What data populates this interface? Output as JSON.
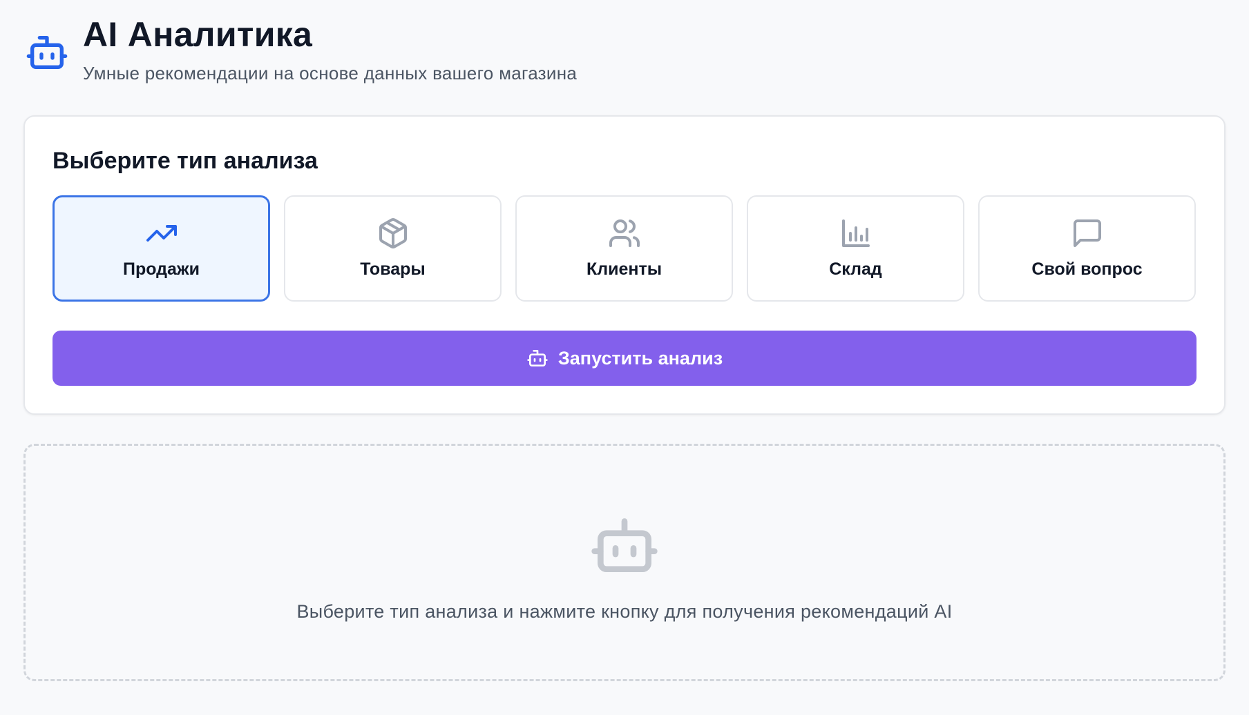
{
  "header": {
    "title": "AI Аналитика",
    "subtitle": "Умные рекомендации на основе данных вашего магазина",
    "icon": "bot-icon"
  },
  "analysis_card": {
    "title": "Выберите тип анализа",
    "selected_index": 0,
    "types": [
      {
        "label": "Продажи",
        "icon": "trending-up-icon"
      },
      {
        "label": "Товары",
        "icon": "package-icon"
      },
      {
        "label": "Клиенты",
        "icon": "users-icon"
      },
      {
        "label": "Склад",
        "icon": "bar-chart-icon"
      },
      {
        "label": "Свой вопрос",
        "icon": "message-square-icon"
      }
    ],
    "run_button": {
      "label": "Запустить анализ",
      "icon": "bot-icon"
    }
  },
  "empty_state": {
    "icon": "bot-icon",
    "message": "Выберите тип анализа и нажмите кнопку для получения рекомендаций AI"
  },
  "colors": {
    "accent_blue": "#2563eb",
    "button_purple": "#8360ec",
    "background": "#f8f9fb",
    "selected_bg": "#eff6ff"
  }
}
